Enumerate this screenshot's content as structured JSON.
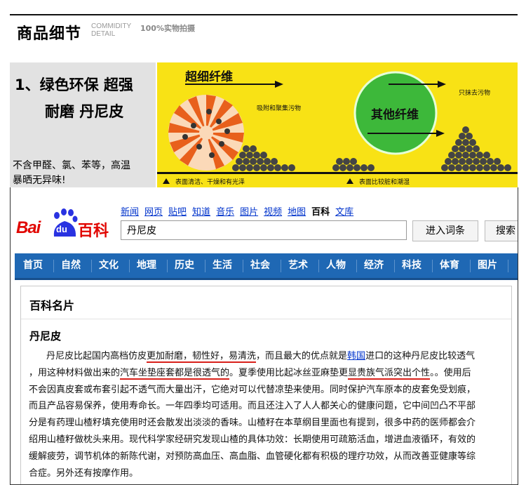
{
  "header": {
    "title": "商品细节",
    "en_line1": "COMMIDITY",
    "en_line2": "DETAIL",
    "subtitle": "100%实物拍摄"
  },
  "banner": {
    "headline_1": "1、绿色环保 超强",
    "headline_2": "耐磨 丹尼皮",
    "desc_1": "不含甲醛、氯、苯等，高温",
    "desc_2": "暴晒无异味!",
    "illustration": {
      "left_title": "超细纤维",
      "left_label": "吸附和聚集污物",
      "right_title": "其他纤维",
      "right_label": "只抹去污物",
      "caption_left": "表面清洁、干燥和有光泽",
      "caption_right": "表面比较脏和潮湿",
      "colors": {
        "background": "#f8e215",
        "green": "#3db83a",
        "orange": "#e8601c"
      }
    }
  },
  "baike": {
    "logo": {
      "bai": "Bai",
      "du": "du",
      "baike": "百科"
    },
    "nav_links": [
      {
        "label": "新闻",
        "current": false
      },
      {
        "label": "网页",
        "current": false
      },
      {
        "label": "贴吧",
        "current": false
      },
      {
        "label": "知道",
        "current": false
      },
      {
        "label": "音乐",
        "current": false
      },
      {
        "label": "图片",
        "current": false
      },
      {
        "label": "视频",
        "current": false
      },
      {
        "label": "地图",
        "current": false
      },
      {
        "label": "百科",
        "current": true
      },
      {
        "label": "文库",
        "current": false
      }
    ],
    "search_value": "丹尼皮",
    "button_enter": "进入词条",
    "button_search": "搜索",
    "categories": [
      "首页",
      "自然",
      "文化",
      "地理",
      "历史",
      "生活",
      "社会",
      "艺术",
      "人物",
      "经济",
      "科技",
      "体育",
      "图片"
    ],
    "panel_title": "百科名片",
    "entry_title": "丹尼皮",
    "paragraph": {
      "l1_a": "丹尼皮比起国内高档仿皮",
      "l1_u": "更加耐磨，韧性好，易清洗",
      "l1_b": "，而且最大的优点就是",
      "l1_link": "韩国",
      "l1_c": "进口的这种丹尼皮比较透气",
      "l2_a": "，用这种材料做出来的",
      "l2_u1": "汽车坐垫座套都是很透气的",
      "l2_b": "。夏季使用比起冰丝亚麻垫更",
      "l2_u2": "显贵族气派突出个性",
      "l2_c": "。。使用后",
      "l3": "不会因真皮套或布套引起不透气而大量出汗，它绝对可以代替凉垫来使用。同时保护汽车原本的皮套免受划痕，",
      "l4": "而且产品容易保养，使用寿命长。一年四季均可适用。而且还注入了人人都关心的健康问题，它中间凹凸不平部",
      "l5": "分是有药理山楂籽填充使用时还会散发出淡淡的香味。山楂籽在本草纲目里面也有提到，很多中药的医师都会介",
      "l6": "绍用山楂籽做枕头来用。现代科学家经研究发现山楂的具体功效：长期使用可疏筋活血，增进血液循环，有效的",
      "l7": "缓解疲劳，调节机体的新陈代谢，对预防高血压、高血脂、血管硬化都有积极的理疗功效，从而改善亚健康等综",
      "l8": "合症。另外还有按摩作用。"
    },
    "colors": {
      "brand_red": "#e10601",
      "logo_blue": "#2932e1",
      "nav_blue": "#1f68b4",
      "link_blue": "#0033cc",
      "underline_red": "#d8201a"
    }
  }
}
